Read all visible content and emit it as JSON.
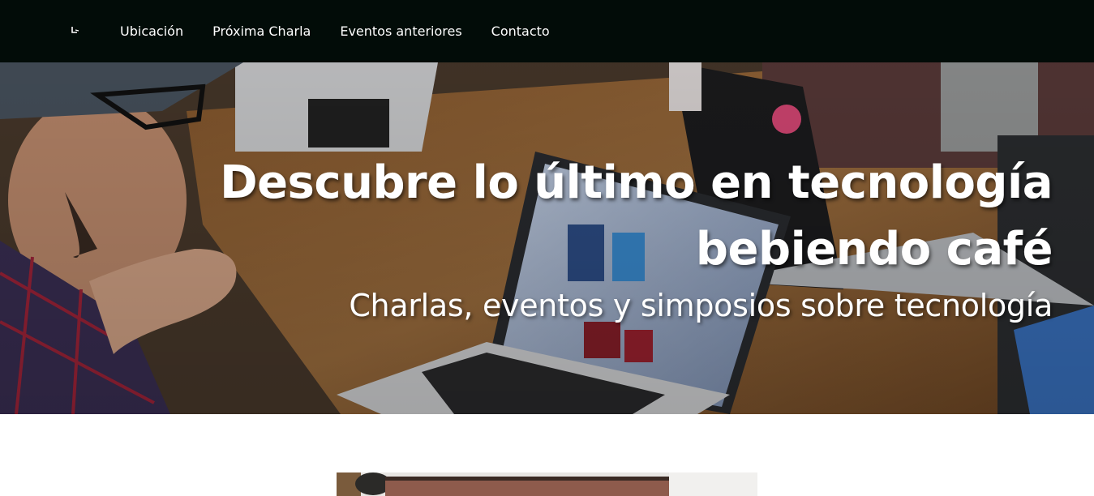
{
  "navbar": {
    "brand_icon": "logo-icon",
    "links": [
      {
        "label": "Ubicación"
      },
      {
        "label": "Próxima Charla"
      },
      {
        "label": "Eventos anteriores"
      },
      {
        "label": "Contacto"
      }
    ]
  },
  "hero": {
    "title_line1": "Descubre lo último en tecnología",
    "title_line2": "bebiendo café",
    "subtitle": "Charlas, eventos y simposios sobre tecnología"
  },
  "colors": {
    "navbar_bg": "#020c08",
    "text": "#ffffff"
  }
}
